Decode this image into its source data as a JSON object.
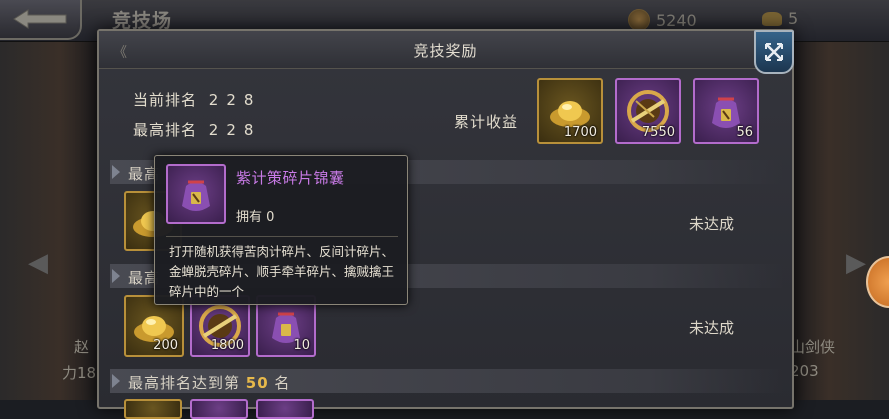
{
  "background": {
    "arena_title": "竞技场",
    "coin_count": "5240",
    "ingot_count": "5",
    "left_char_name": "赵",
    "left_char_num": "力18",
    "right_char_name": "山剑侠",
    "right_char_num": "203"
  },
  "dialog": {
    "title": "竞技奖励",
    "current_rank_label": "当前排名",
    "current_rank_value": "228",
    "best_rank_label": "最高排名",
    "best_rank_value": "228",
    "earnings_label": "累计收益",
    "earnings": [
      {
        "icon": "gold-ingot-icon",
        "qty": "1700"
      },
      {
        "icon": "strategy-shard-icon",
        "qty": "7550"
      },
      {
        "icon": "purple-pouch-icon",
        "qty": "56"
      }
    ],
    "sections": [
      {
        "prefix": "最高",
        "num": "",
        "suffix": "",
        "status": "未达成"
      },
      {
        "prefix": "最高",
        "num": "",
        "suffix": "",
        "status": "未达成",
        "rewards": [
          {
            "icon": "gold-ingot-icon",
            "qty": "200"
          },
          {
            "icon": "strategy-shard-icon",
            "qty": "1800"
          },
          {
            "icon": "purple-pouch-icon",
            "qty": "10"
          }
        ]
      },
      {
        "prefix": "最高排名达到第 ",
        "num": "50",
        "suffix": " 名",
        "status": ""
      }
    ]
  },
  "tooltip": {
    "name": "紫计策碎片锦囊",
    "own_label": "拥有",
    "own_count": "0",
    "description": "打开随机获得苦肉计碎片、反间计碎片、金蝉脱壳碎片、顺手牵羊碎片、擒贼擒王碎片中的一个"
  },
  "colors": {
    "gold_border": "#b8903a",
    "purple_border": "#b36ccc",
    "purple_text": "#c87ae6",
    "highlight_num": "#e7b94b"
  }
}
